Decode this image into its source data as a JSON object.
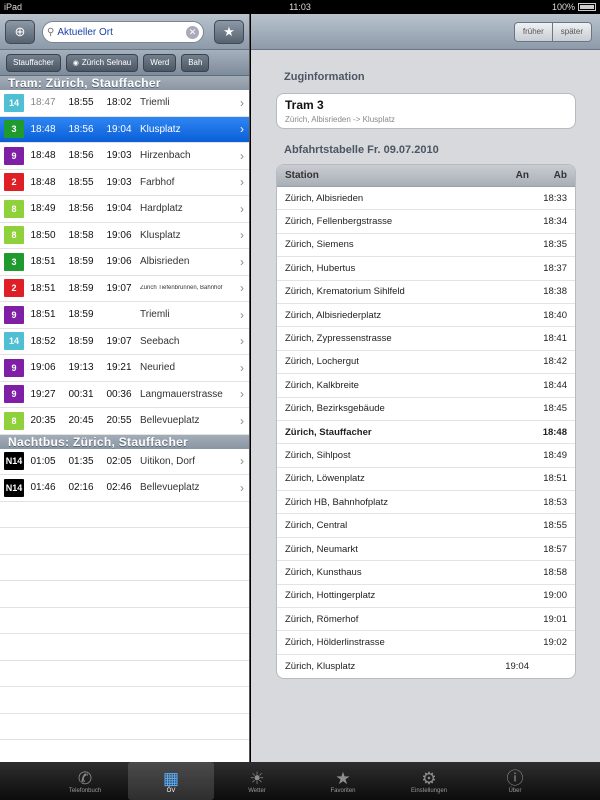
{
  "status": {
    "device": "iPad",
    "time": "11:03",
    "battery": "100%"
  },
  "search": {
    "value": "Aktueller Ort"
  },
  "chips": [
    "Stauffacher",
    "Zürich Selnau",
    "Werd",
    "Bah"
  ],
  "sections": {
    "tram": "Tram: Zürich, Stauffacher",
    "bus": "Nachtbus: Zürich, Stauffacher"
  },
  "departures": [
    {
      "line": "14",
      "color": "#4fbfd3",
      "t1": "18:47",
      "t2": "18:55",
      "t3": "18:02",
      "dest": "Triemli",
      "dim1": true
    },
    {
      "line": "3",
      "color": "#1f9a2e",
      "t1": "18:48",
      "t2": "18:56",
      "t3": "19:04",
      "dest": "Klusplatz",
      "selected": true
    },
    {
      "line": "9",
      "color": "#7e1fa6",
      "t1": "18:48",
      "t2": "18:56",
      "t3": "19:03",
      "dest": "Hirzenbach"
    },
    {
      "line": "2",
      "color": "#de1f26",
      "t1": "18:48",
      "t2": "18:55",
      "t3": "19:03",
      "dest": "Farbhof"
    },
    {
      "line": "8",
      "color": "#8fd13a",
      "t1": "18:49",
      "t2": "18:56",
      "t3": "19:04",
      "dest": "Hardplatz"
    },
    {
      "line": "8",
      "color": "#8fd13a",
      "t1": "18:50",
      "t2": "18:58",
      "t3": "19:06",
      "dest": "Klusplatz"
    },
    {
      "line": "3",
      "color": "#1f9a2e",
      "t1": "18:51",
      "t2": "18:59",
      "t3": "19:06",
      "dest": "Albisrieden"
    },
    {
      "line": "2",
      "color": "#de1f26",
      "t1": "18:51",
      "t2": "18:59",
      "t3": "19:07",
      "dest": "Zürich Tiefenbrunnen, Bahnhof",
      "small": true
    },
    {
      "line": "9",
      "color": "#7e1fa6",
      "t1": "18:51",
      "t2": "18:59",
      "t3": "",
      "dest": "Triemli"
    },
    {
      "line": "14",
      "color": "#4fbfd3",
      "t1": "18:52",
      "t2": "18:59",
      "t3": "19:07",
      "dest": "Seebach"
    },
    {
      "line": "9",
      "color": "#7e1fa6",
      "t1": "19:06",
      "t2": "19:13",
      "t3": "19:21",
      "dest": "Neuried"
    },
    {
      "line": "9",
      "color": "#7e1fa6",
      "t1": "19:27",
      "t2": "00:31",
      "t3": "00:36",
      "dest": "Langmauerstrasse"
    },
    {
      "line": "8",
      "color": "#8fd13a",
      "t1": "20:35",
      "t2": "20:45",
      "t3": "20:55",
      "dest": "Bellevueplatz"
    }
  ],
  "night": [
    {
      "line": "N14",
      "color": "#000000",
      "t1": "01:05",
      "t2": "01:35",
      "t3": "02:05",
      "dest": "Uitikon, Dorf"
    },
    {
      "line": "N14",
      "color": "#000000",
      "t1": "01:46",
      "t2": "02:16",
      "t3": "02:46",
      "dest": "Bellevueplatz"
    }
  ],
  "right": {
    "seg_prev": "früher",
    "seg_next": "später",
    "zug_label": "Zuginformation",
    "zug_title": "Tram 3",
    "zug_sub": "Zürich, Albisrieden -> Klusplatz",
    "abf_label": "Abfahrtstabelle Fr. 09.07.2010",
    "cols": {
      "station": "Station",
      "an": "An",
      "ab": "Ab"
    },
    "stops": [
      {
        "station": "Zürich, Albisrieden",
        "an": "",
        "ab": "18:33"
      },
      {
        "station": "Zürich, Fellenbergstrasse",
        "an": "",
        "ab": "18:34"
      },
      {
        "station": "Zürich, Siemens",
        "an": "",
        "ab": "18:35"
      },
      {
        "station": "Zürich, Hubertus",
        "an": "",
        "ab": "18:37"
      },
      {
        "station": "Zürich, Krematorium Sihlfeld",
        "an": "",
        "ab": "18:38"
      },
      {
        "station": "Zürich, Albisriederplatz",
        "an": "",
        "ab": "18:40"
      },
      {
        "station": "Zürich, Zypressenstrasse",
        "an": "",
        "ab": "18:41"
      },
      {
        "station": "Zürich, Lochergut",
        "an": "",
        "ab": "18:42"
      },
      {
        "station": "Zürich, Kalkbreite",
        "an": "",
        "ab": "18:44"
      },
      {
        "station": "Zürich, Bezirksgebäude",
        "an": "",
        "ab": "18:45"
      },
      {
        "station": "Zürich, Stauffacher",
        "an": "",
        "ab": "18:48",
        "bold": true
      },
      {
        "station": "Zürich, Sihlpost",
        "an": "",
        "ab": "18:49"
      },
      {
        "station": "Zürich, Löwenplatz",
        "an": "",
        "ab": "18:51"
      },
      {
        "station": "Zürich HB, Bahnhofplatz",
        "an": "",
        "ab": "18:53"
      },
      {
        "station": "Zürich, Central",
        "an": "",
        "ab": "18:55"
      },
      {
        "station": "Zürich, Neumarkt",
        "an": "",
        "ab": "18:57"
      },
      {
        "station": "Zürich, Kunsthaus",
        "an": "",
        "ab": "18:58"
      },
      {
        "station": "Zürich, Hottingerplatz",
        "an": "",
        "ab": "19:00"
      },
      {
        "station": "Zürich, Römerhof",
        "an": "",
        "ab": "19:01"
      },
      {
        "station": "Zürich, Hölderlinstrasse",
        "an": "",
        "ab": "19:02"
      },
      {
        "station": "Zürich, Klusplatz",
        "an": "19:04",
        "ab": ""
      }
    ]
  },
  "tabs": [
    {
      "label": "Telefonbuch",
      "icon": "phone-icon",
      "glyph": "✆"
    },
    {
      "label": "ÖV",
      "icon": "tram-icon",
      "glyph": "▦",
      "active": true
    },
    {
      "label": "Wetter",
      "icon": "sun-icon",
      "glyph": "☀"
    },
    {
      "label": "Favoriten",
      "icon": "star-icon",
      "glyph": "★"
    },
    {
      "label": "Einstellungen",
      "icon": "gear-icon",
      "glyph": "⚙"
    },
    {
      "label": "Über",
      "icon": "info-icon",
      "glyph": "ⓘ"
    }
  ]
}
